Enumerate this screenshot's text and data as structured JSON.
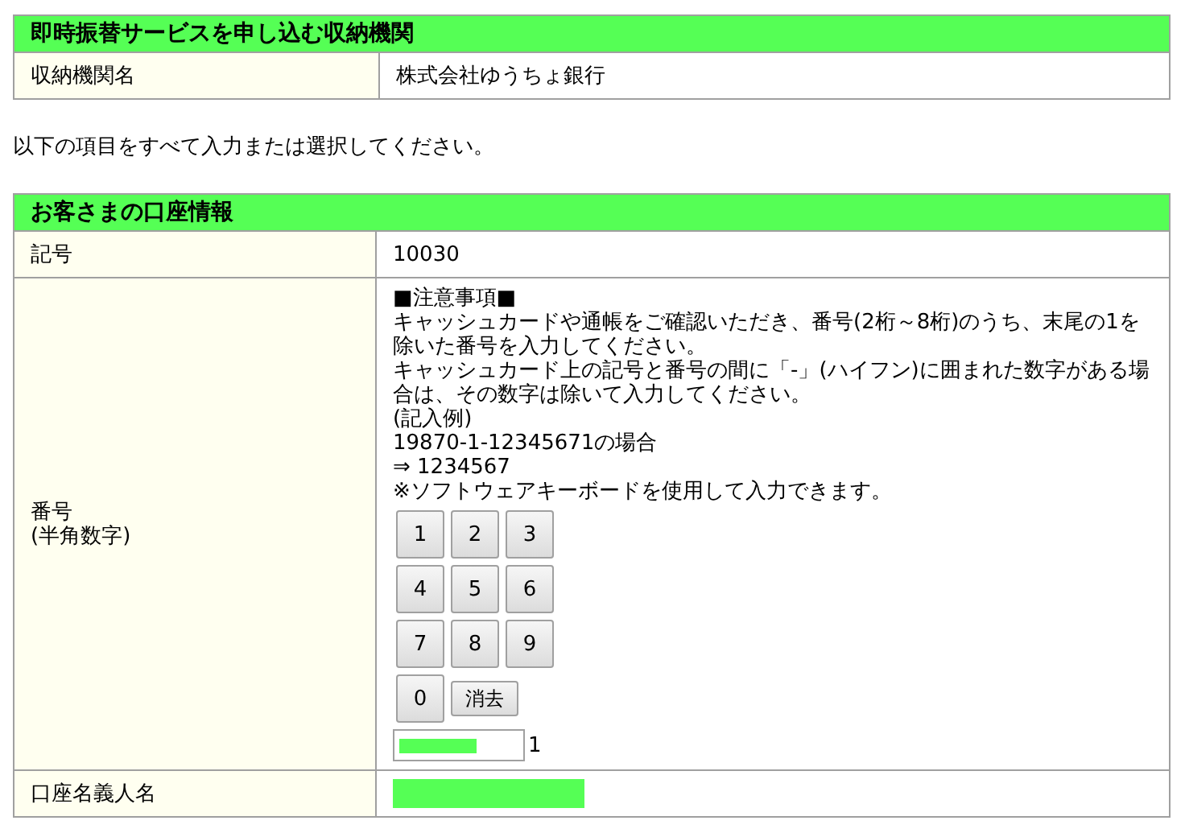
{
  "institution_section": {
    "title": "即時振替サービスを申し込む収納機関",
    "rows": [
      {
        "label": "収納機関名",
        "value": "株式会社ゆうちょ銀行"
      }
    ]
  },
  "instruction": "以下の項目をすべて入力または選択してください。",
  "account_section": {
    "title": "お客さまの口座情報",
    "symbol_row": {
      "label": "記号",
      "value": "10030"
    },
    "number_row": {
      "label": "番号",
      "sublabel": "(半角数字)",
      "notes": [
        "■注意事項■",
        "キャッシュカードや通帳をご確認いただき、番号(2桁～8桁)のうち、末尾の1を除いた番号を入力してください。",
        "キャッシュカード上の記号と番号の間に「-」(ハイフン)に囲まれた数字がある場合は、その数字は除いて入力してください。",
        "(記入例)",
        "19870-1-12345671の場合",
        "⇒ 1234567",
        "※ソフトウェアキーボードを使用して入力できます。"
      ],
      "keypad": [
        [
          "1",
          "2",
          "3"
        ],
        [
          "4",
          "5",
          "6"
        ],
        [
          "7",
          "8",
          "9"
        ],
        [
          "0"
        ]
      ],
      "clear_button": "消去",
      "number_input": {
        "redacted": true
      },
      "suffix": "1"
    },
    "holder_row": {
      "label": "口座名義人名",
      "redacted": true
    }
  }
}
